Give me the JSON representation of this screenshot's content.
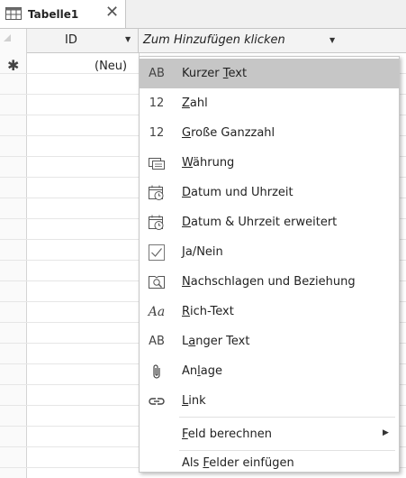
{
  "tab": {
    "title": "Tabelle1",
    "close": "✕"
  },
  "grid": {
    "columns": [
      {
        "label": "ID",
        "arrow": "▼"
      },
      {
        "label": "Zum Hinzufügen klicken",
        "arrow": "▼"
      }
    ],
    "new_row": {
      "marker": "✱",
      "value": "(Neu)"
    }
  },
  "menu": {
    "items": [
      {
        "icon": "AB",
        "pre": "Kurzer ",
        "acc": "T",
        "post": "ext",
        "highlighted": true
      },
      {
        "icon": "12",
        "pre": "",
        "acc": "Z",
        "post": "ahl"
      },
      {
        "icon": "12",
        "pre": "",
        "acc": "G",
        "post": "roße Ganzzahl"
      },
      {
        "icon": "currency-icon",
        "pre": "",
        "acc": "W",
        "post": "ährung"
      },
      {
        "icon": "calendar-clock-icon",
        "pre": "",
        "acc": "D",
        "post": "atum und Uhrzeit"
      },
      {
        "icon": "calendar-clock-icon",
        "pre": "",
        "acc": "D",
        "post": "atum & Uhrzeit erweitert"
      },
      {
        "icon": "checkbox-icon",
        "pre": "",
        "acc": "J",
        "post": "a/Nein"
      },
      {
        "icon": "lookup-icon",
        "pre": "",
        "acc": "N",
        "post": "achschlagen und Beziehung"
      },
      {
        "icon": "Aa",
        "pre": "",
        "acc": "R",
        "post": "ich-Text"
      },
      {
        "icon": "AB",
        "pre": "L",
        "acc": "a",
        "post": "nger Text"
      },
      {
        "icon": "paperclip-icon",
        "pre": "An",
        "acc": "l",
        "post": "age"
      },
      {
        "icon": "link-icon",
        "pre": "",
        "acc": "L",
        "post": "ink"
      },
      {
        "icon": "",
        "pre": "",
        "acc": "F",
        "post": "eld berechnen",
        "submenu": "▶"
      },
      {
        "icon": "",
        "pre": "Als ",
        "acc": "F",
        "post": "elder einfügen"
      }
    ]
  }
}
